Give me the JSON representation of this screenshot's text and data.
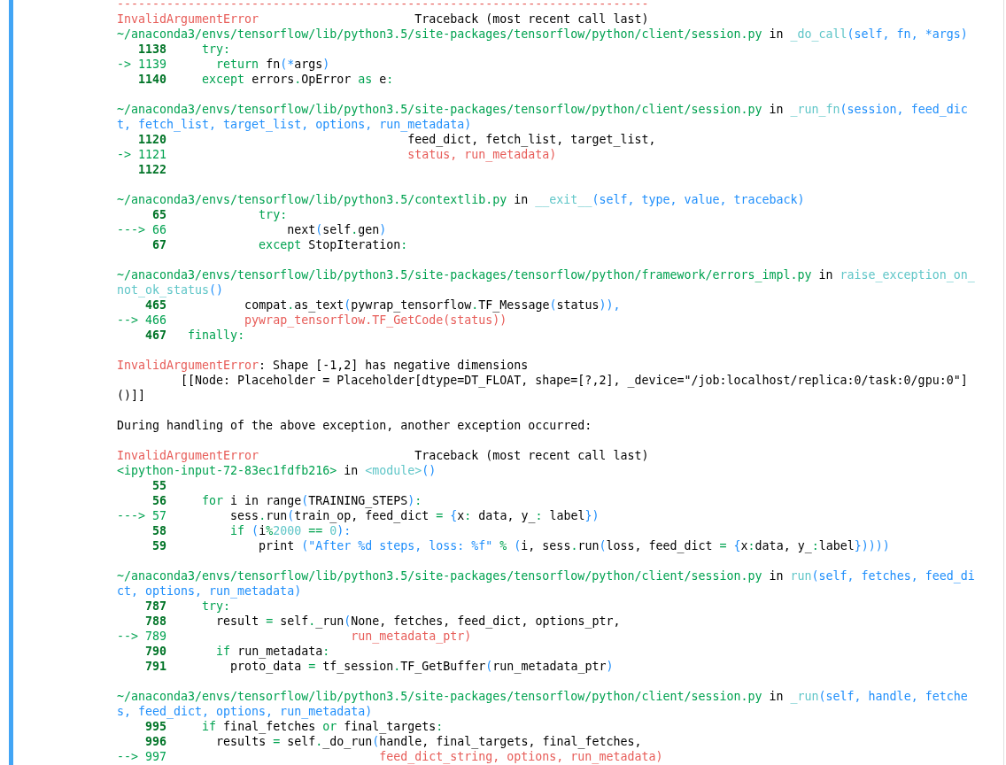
{
  "output": {
    "blocks": [
      {
        "lines": [
          {
            "parts": [
              {
                "kind": "err",
                "text": "---------------------------------------------------------------------------"
              }
            ]
          },
          {
            "parts": [
              {
                "kind": "err",
                "text": "InvalidArgumentError"
              },
              {
                "kind": "plain",
                "text": "                      Traceback (most recent call last)"
              }
            ]
          },
          {
            "parts": [
              {
                "kind": "loc",
                "text": "~/anaconda3/envs/tensorflow/lib/python3.5/site-packages/tensorflow/python/client/session.py"
              },
              {
                "kind": "plain",
                "text": " in "
              },
              {
                "kind": "mod",
                "text": "_do_call"
              },
              {
                "kind": "arg",
                "text": "(self, fn, *args)"
              }
            ]
          },
          {
            "parts": [
              {
                "kind": "num",
                "text": "   1138"
              },
              {
                "kind": "kw",
                "text": "     try"
              },
              {
                "kind": "op",
                "text": ":"
              }
            ]
          },
          {
            "parts": [
              {
                "kind": "loc",
                "text": "-> 1139"
              },
              {
                "kind": "kw",
                "text": "       return"
              },
              {
                "kind": "plain",
                "text": " fn"
              },
              {
                "kind": "arg",
                "text": "(*"
              },
              {
                "kind": "plain",
                "text": "args"
              },
              {
                "kind": "arg",
                "text": ")"
              }
            ]
          },
          {
            "parts": [
              {
                "kind": "num",
                "text": "   1140"
              },
              {
                "kind": "kw",
                "text": "     except"
              },
              {
                "kind": "plain",
                "text": " errors"
              },
              {
                "kind": "op",
                "text": "."
              },
              {
                "kind": "plain",
                "text": "OpError "
              },
              {
                "kind": "kw",
                "text": "as"
              },
              {
                "kind": "plain",
                "text": " e"
              },
              {
                "kind": "op",
                "text": ":"
              }
            ]
          }
        ]
      },
      {
        "lines": [
          {
            "parts": [
              {
                "kind": "loc",
                "text": "~/anaconda3/envs/tensorflow/lib/python3.5/site-packages/tensorflow/python/client/session.py"
              },
              {
                "kind": "plain",
                "text": " in "
              },
              {
                "kind": "mod",
                "text": "_run_fn"
              },
              {
                "kind": "arg",
                "text": "(session, feed_dict, fetch_list, target_list, options, run_metadata)"
              }
            ]
          },
          {
            "parts": [
              {
                "kind": "num",
                "text": "   1120"
              },
              {
                "kind": "plain",
                "text": "                                  feed_dict, fetch_list, target_list,"
              }
            ]
          },
          {
            "parts": [
              {
                "kind": "loc",
                "text": "-> 1121"
              },
              {
                "kind": "err",
                "text": "                                  status, run_metadata)"
              }
            ]
          },
          {
            "parts": [
              {
                "kind": "num",
                "text": "   1122"
              }
            ]
          }
        ]
      },
      {
        "lines": [
          {
            "parts": [
              {
                "kind": "loc",
                "text": "~/anaconda3/envs/tensorflow/lib/python3.5/contextlib.py"
              },
              {
                "kind": "plain",
                "text": " in "
              },
              {
                "kind": "mod",
                "text": "__exit__"
              },
              {
                "kind": "arg",
                "text": "(self, type, value, traceback)"
              }
            ]
          },
          {
            "parts": [
              {
                "kind": "num",
                "text": "     65"
              },
              {
                "kind": "kw",
                "text": "             try"
              },
              {
                "kind": "op",
                "text": ":"
              }
            ]
          },
          {
            "parts": [
              {
                "kind": "loc",
                "text": "---> 66"
              },
              {
                "kind": "plain",
                "text": "                 next"
              },
              {
                "kind": "arg",
                "text": "("
              },
              {
                "kind": "plain",
                "text": "self"
              },
              {
                "kind": "op",
                "text": "."
              },
              {
                "kind": "plain",
                "text": "gen"
              },
              {
                "kind": "arg",
                "text": ")"
              }
            ]
          },
          {
            "parts": [
              {
                "kind": "num",
                "text": "     67"
              },
              {
                "kind": "kw",
                "text": "             except"
              },
              {
                "kind": "plain",
                "text": " StopIteration"
              },
              {
                "kind": "op",
                "text": ":"
              }
            ]
          }
        ]
      },
      {
        "lines": [
          {
            "parts": [
              {
                "kind": "loc",
                "text": "~/anaconda3/envs/tensorflow/lib/python3.5/site-packages/tensorflow/python/framework/errors_impl.py"
              },
              {
                "kind": "plain",
                "text": " in "
              },
              {
                "kind": "mod",
                "text": "raise_exception_on_not_ok_status"
              },
              {
                "kind": "arg",
                "text": "()"
              }
            ]
          },
          {
            "parts": [
              {
                "kind": "num",
                "text": "    465"
              },
              {
                "kind": "plain",
                "text": "           compat"
              },
              {
                "kind": "op",
                "text": "."
              },
              {
                "kind": "plain",
                "text": "as_text"
              },
              {
                "kind": "arg",
                "text": "("
              },
              {
                "kind": "plain",
                "text": "pywrap_tensorflow"
              },
              {
                "kind": "op",
                "text": "."
              },
              {
                "kind": "plain",
                "text": "TF_Message"
              },
              {
                "kind": "arg",
                "text": "("
              },
              {
                "kind": "plain",
                "text": "status"
              },
              {
                "kind": "arg",
                "text": ")),"
              }
            ]
          },
          {
            "parts": [
              {
                "kind": "loc",
                "text": "--> 466"
              },
              {
                "kind": "err",
                "text": "           pywrap_tensorflow.TF_GetCode(status))"
              }
            ]
          },
          {
            "parts": [
              {
                "kind": "num",
                "text": "    467"
              },
              {
                "kind": "kw",
                "text": "   finally"
              },
              {
                "kind": "op",
                "text": ":"
              }
            ]
          }
        ]
      },
      {
        "lines": [
          {
            "parts": [
              {
                "kind": "err",
                "text": "InvalidArgumentError"
              },
              {
                "kind": "plain",
                "text": ": Shape [-1,2] has negative dimensions"
              }
            ]
          },
          {
            "parts": [
              {
                "kind": "plain",
                "text": "         [[Node: Placeholder = Placeholder[dtype=DT_FLOAT, shape=[?,2], _device=\"/job:localhost/replica:0/task:0/gpu:0\"]()]]"
              }
            ]
          }
        ]
      },
      {
        "lines": [
          {
            "parts": [
              {
                "kind": "plain",
                "text": "During handling of the above exception, another exception occurred:"
              }
            ]
          }
        ]
      },
      {
        "lines": [
          {
            "parts": [
              {
                "kind": "err",
                "text": "InvalidArgumentError"
              },
              {
                "kind": "plain",
                "text": "                      Traceback (most recent call last)"
              }
            ]
          },
          {
            "parts": [
              {
                "kind": "loc",
                "text": "<ipython-input-72-83ec1fdfb216>"
              },
              {
                "kind": "plain",
                "text": " in "
              },
              {
                "kind": "mod",
                "text": "<module>"
              },
              {
                "kind": "arg",
                "text": "()"
              }
            ]
          },
          {
            "parts": [
              {
                "kind": "num",
                "text": "     55"
              }
            ]
          },
          {
            "parts": [
              {
                "kind": "num",
                "text": "     56"
              },
              {
                "kind": "kw",
                "text": "     for"
              },
              {
                "kind": "plain",
                "text": " i in range"
              },
              {
                "kind": "arg",
                "text": "("
              },
              {
                "kind": "plain",
                "text": "TRAINING_STEPS"
              },
              {
                "kind": "arg",
                "text": ")"
              },
              {
                "kind": "op",
                "text": ":"
              }
            ]
          },
          {
            "parts": [
              {
                "kind": "loc",
                "text": "---> 57"
              },
              {
                "kind": "plain",
                "text": "         sess"
              },
              {
                "kind": "op",
                "text": "."
              },
              {
                "kind": "plain",
                "text": "run"
              },
              {
                "kind": "arg",
                "text": "("
              },
              {
                "kind": "plain",
                "text": "train_op, feed_dict "
              },
              {
                "kind": "op",
                "text": "="
              },
              {
                "kind": "arg",
                "text": " {"
              },
              {
                "kind": "plain",
                "text": "x"
              },
              {
                "kind": "op",
                "text": ":"
              },
              {
                "kind": "plain",
                "text": " data, y_"
              },
              {
                "kind": "op",
                "text": ":"
              },
              {
                "kind": "plain",
                "text": " label"
              },
              {
                "kind": "arg",
                "text": "})"
              }
            ]
          },
          {
            "parts": [
              {
                "kind": "num",
                "text": "     58"
              },
              {
                "kind": "kw",
                "text": "         if"
              },
              {
                "kind": "arg",
                "text": " ("
              },
              {
                "kind": "plain",
                "text": "i"
              },
              {
                "kind": "op",
                "text": "%"
              },
              {
                "kind": "mod",
                "text": "2000"
              },
              {
                "kind": "op",
                "text": " =="
              },
              {
                "kind": "mod",
                "text": " 0"
              },
              {
                "kind": "arg",
                "text": "):"
              }
            ]
          },
          {
            "parts": [
              {
                "kind": "num",
                "text": "     59"
              },
              {
                "kind": "plain",
                "text": "             print "
              },
              {
                "kind": "arg",
                "text": "(\"After %d steps, loss: %f\""
              },
              {
                "kind": "op",
                "text": " %"
              },
              {
                "kind": "arg",
                "text": " ("
              },
              {
                "kind": "plain",
                "text": "i, sess"
              },
              {
                "kind": "op",
                "text": "."
              },
              {
                "kind": "plain",
                "text": "run"
              },
              {
                "kind": "arg",
                "text": "("
              },
              {
                "kind": "plain",
                "text": "loss, feed_dict "
              },
              {
                "kind": "op",
                "text": "="
              },
              {
                "kind": "arg",
                "text": " {"
              },
              {
                "kind": "plain",
                "text": "x"
              },
              {
                "kind": "op",
                "text": ":"
              },
              {
                "kind": "plain",
                "text": "data, y_"
              },
              {
                "kind": "op",
                "text": ":"
              },
              {
                "kind": "plain",
                "text": "label"
              },
              {
                "kind": "arg",
                "text": "}))))"
              }
            ]
          }
        ]
      },
      {
        "lines": [
          {
            "parts": [
              {
                "kind": "loc",
                "text": "~/anaconda3/envs/tensorflow/lib/python3.5/site-packages/tensorflow/python/client/session.py"
              },
              {
                "kind": "plain",
                "text": " in "
              },
              {
                "kind": "mod",
                "text": "run"
              },
              {
                "kind": "arg",
                "text": "(self, fetches, feed_dict, options, run_metadata)"
              }
            ]
          },
          {
            "parts": [
              {
                "kind": "num",
                "text": "    787"
              },
              {
                "kind": "kw",
                "text": "     try"
              },
              {
                "kind": "op",
                "text": ":"
              }
            ]
          },
          {
            "parts": [
              {
                "kind": "num",
                "text": "    788"
              },
              {
                "kind": "plain",
                "text": "       result "
              },
              {
                "kind": "op",
                "text": "="
              },
              {
                "kind": "plain",
                "text": " self"
              },
              {
                "kind": "op",
                "text": "."
              },
              {
                "kind": "plain",
                "text": "_run"
              },
              {
                "kind": "arg",
                "text": "("
              },
              {
                "kind": "plain",
                "text": "None, fetches, feed_dict, options_ptr,"
              }
            ]
          },
          {
            "parts": [
              {
                "kind": "loc",
                "text": "--> 789"
              },
              {
                "kind": "err",
                "text": "                          run_metadata_ptr)"
              }
            ]
          },
          {
            "parts": [
              {
                "kind": "num",
                "text": "    790"
              },
              {
                "kind": "kw",
                "text": "       if"
              },
              {
                "kind": "plain",
                "text": " run_metadata"
              },
              {
                "kind": "op",
                "text": ":"
              }
            ]
          },
          {
            "parts": [
              {
                "kind": "num",
                "text": "    791"
              },
              {
                "kind": "plain",
                "text": "         proto_data "
              },
              {
                "kind": "op",
                "text": "="
              },
              {
                "kind": "plain",
                "text": " tf_session"
              },
              {
                "kind": "op",
                "text": "."
              },
              {
                "kind": "plain",
                "text": "TF_GetBuffer"
              },
              {
                "kind": "arg",
                "text": "("
              },
              {
                "kind": "plain",
                "text": "run_metadata_ptr"
              },
              {
                "kind": "arg",
                "text": ")"
              }
            ]
          }
        ]
      },
      {
        "lines": [
          {
            "parts": [
              {
                "kind": "loc",
                "text": "~/anaconda3/envs/tensorflow/lib/python3.5/site-packages/tensorflow/python/client/session.py"
              },
              {
                "kind": "plain",
                "text": " in "
              },
              {
                "kind": "mod",
                "text": "_run"
              },
              {
                "kind": "arg",
                "text": "(self, handle, fetches, feed_dict, options, run_metadata)"
              }
            ]
          },
          {
            "parts": [
              {
                "kind": "num",
                "text": "    995"
              },
              {
                "kind": "kw",
                "text": "     if"
              },
              {
                "kind": "plain",
                "text": " final_fetches "
              },
              {
                "kind": "kw",
                "text": "or"
              },
              {
                "kind": "plain",
                "text": " final_targets"
              },
              {
                "kind": "op",
                "text": ":"
              }
            ]
          },
          {
            "parts": [
              {
                "kind": "num",
                "text": "    996"
              },
              {
                "kind": "plain",
                "text": "       results "
              },
              {
                "kind": "op",
                "text": "="
              },
              {
                "kind": "plain",
                "text": " self"
              },
              {
                "kind": "op",
                "text": "."
              },
              {
                "kind": "plain",
                "text": "_do_run"
              },
              {
                "kind": "arg",
                "text": "("
              },
              {
                "kind": "plain",
                "text": "handle, final_targets, final_fetches,"
              }
            ]
          },
          {
            "parts": [
              {
                "kind": "loc",
                "text": "--> 997"
              },
              {
                "kind": "err",
                "text": "                              feed_dict_string, options, run_metadata)"
              }
            ]
          }
        ]
      }
    ]
  }
}
